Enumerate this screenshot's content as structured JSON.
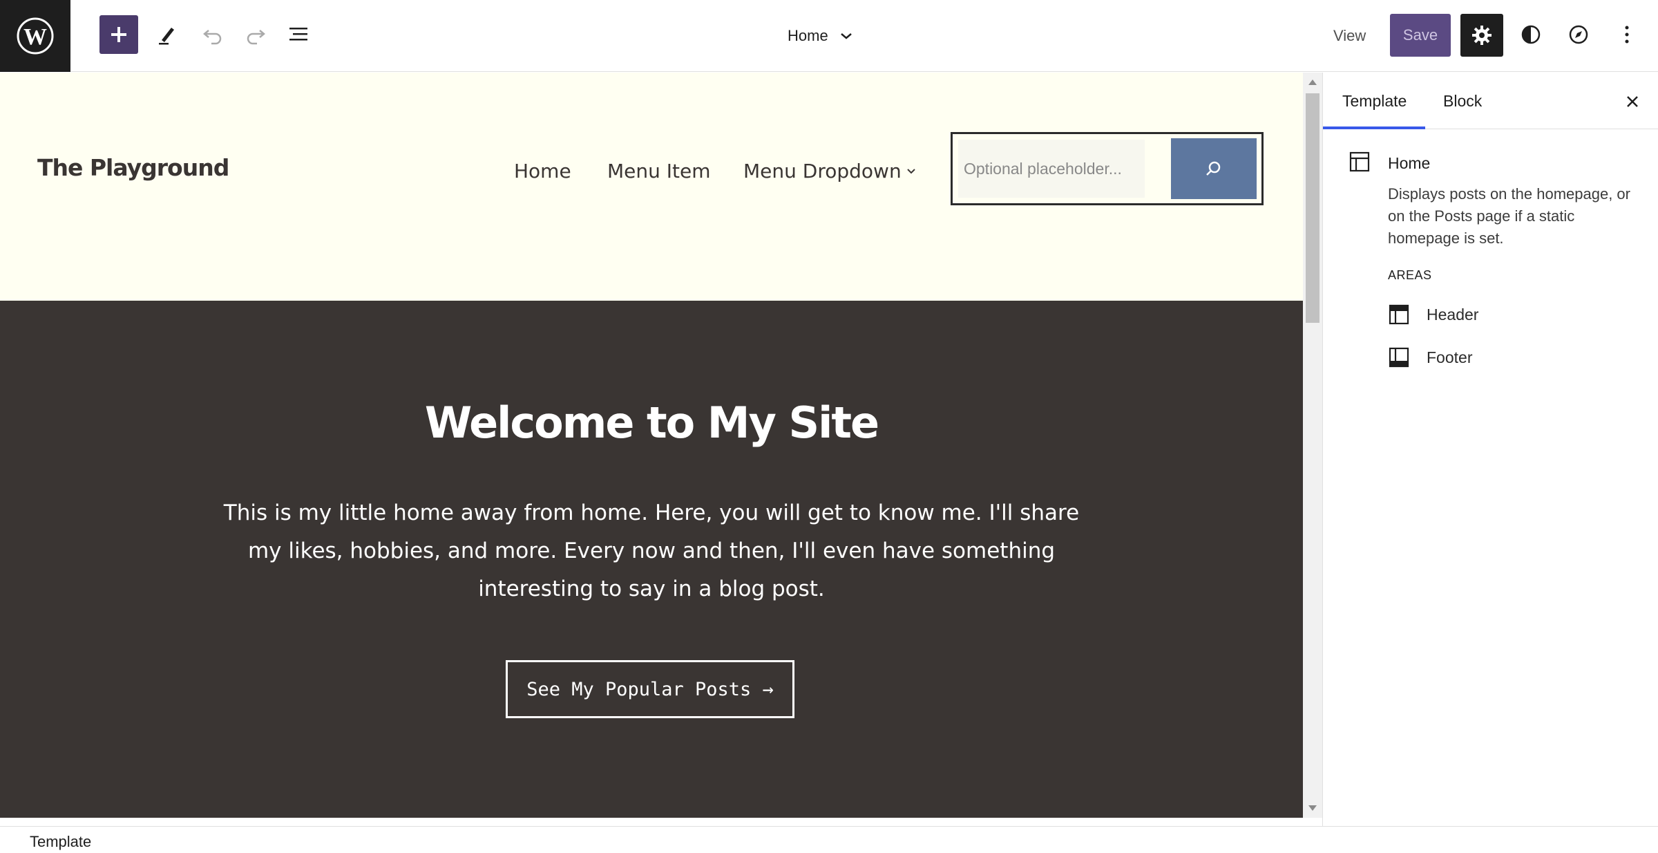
{
  "toolbar": {
    "logo": "wordpress-logo",
    "add_icon": "plus-icon",
    "edit_icon": "pencil-icon",
    "undo_icon": "undo-icon",
    "redo_icon": "redo-icon",
    "list_view_icon": "list-view-icon",
    "document_title": "Home",
    "view_label": "View",
    "save_label": "Save",
    "settings_icon": "gear-icon",
    "styles_icon": "half-circle-icon",
    "navigation_icon": "compass-icon",
    "options_icon": "more-vertical-icon",
    "accent_color": "#4a3b6b"
  },
  "site": {
    "title": "The Playground",
    "nav": [
      {
        "label": "Home"
      },
      {
        "label": "Menu Item"
      },
      {
        "label": "Menu Dropdown"
      }
    ],
    "search_placeholder": "Optional placeholder...",
    "header_bg": "#fffff2",
    "search_button_color": "#5d779f"
  },
  "hero": {
    "title": "Welcome to My Site",
    "text": "This is my little home away from home. Here, you will get to know me.  I'll share my likes, hobbies, and more.  Every now and then, I'll even have something interesting to say in a blog post.",
    "button_label": "See My Popular Posts →",
    "bg": "#3a3533"
  },
  "sidebar": {
    "tabs": [
      {
        "label": "Template"
      },
      {
        "label": "Block"
      }
    ],
    "template_name": "Home",
    "template_description": "Displays posts on the homepage, or on the Posts page if a static homepage is set.",
    "areas_label": "AREAS",
    "areas": [
      {
        "label": "Header",
        "icon": "header-layout-icon"
      },
      {
        "label": "Footer",
        "icon": "footer-layout-icon"
      }
    ]
  },
  "statusbar": {
    "breadcrumb": "Template"
  }
}
